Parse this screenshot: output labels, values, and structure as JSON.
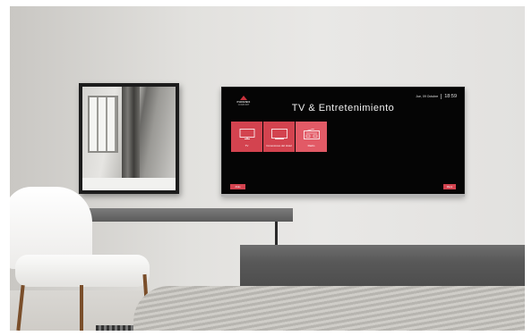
{
  "tv": {
    "logo_name": "PHOENIX",
    "logo_sub": "COMFORT",
    "date": "Jue, 09 Octubre",
    "time": "18:59",
    "title": "TV & Entretenimiento",
    "tiles": [
      {
        "label": "TV",
        "icon": "tv-icon",
        "selected": false
      },
      {
        "label": "Conexiones del Hotel",
        "icon": "screen-cast-icon",
        "selected": false
      },
      {
        "label": "Radio",
        "icon": "radio-icon",
        "selected": true
      }
    ],
    "back_label": "Atrás",
    "menu_label": "Menú"
  },
  "colors": {
    "accent": "#d3434f",
    "accent_selected": "#e25a66",
    "screen_bg": "#050505"
  }
}
